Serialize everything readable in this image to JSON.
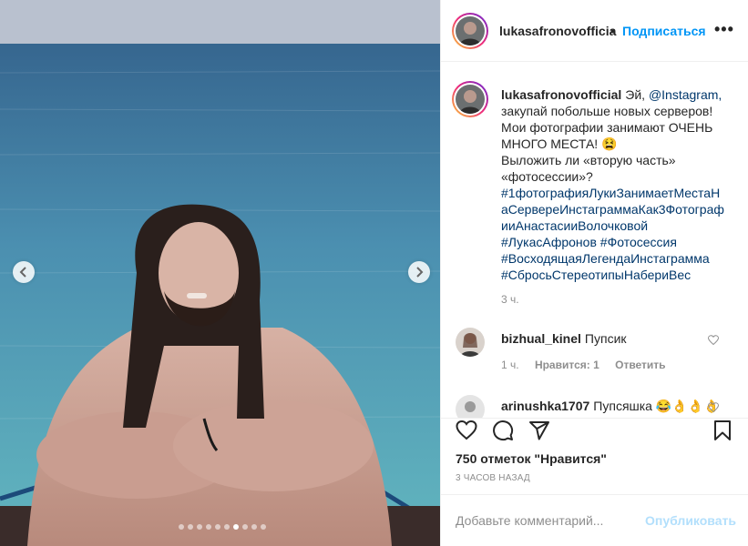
{
  "post": {
    "username": "lukasafronovofficia",
    "separator": "•",
    "follow_label": "Подписаться",
    "more_icon": "more-horizontal-icon",
    "more_label": "•••"
  },
  "caption": {
    "username": "lukasafronovofficial",
    "text_1": "Эй,",
    "mention": "@Instagram,",
    "text_2": "закупай побольше новых серверов! Мои фотографии занимают ОЧЕНЬ МНОГО МЕСТА! 😫",
    "text_3": "Выложить ли «вторую часть» «фотосессии»?",
    "hashtags": [
      "#1фотографияЛукиЗанимаетМестаНаСервереИнстаграммаКак3ФотографииАнастасииВолочковой",
      "#ЛукасАфронов #Фотосессия",
      "#ВосходящаяЛегендаИнстаграмма",
      "#СбросьСтереотипыНабериВес"
    ],
    "time": "3 ч."
  },
  "comments": [
    {
      "username": "bizhual_kinel",
      "text": "Пупсик",
      "time": "1 ч.",
      "likes": "Нравится: 1",
      "reply": "Ответить"
    },
    {
      "username": "arinushka1707",
      "text": "Пупсяшка 😂👌👌👌"
    }
  ],
  "actions": {
    "like_icon": "heart-icon",
    "comment_icon": "comment-icon",
    "share_icon": "share-icon",
    "save_icon": "bookmark-icon"
  },
  "likes_count": "750 отметок \"Нравится\"",
  "post_time": "3 часов назад",
  "add_comment": {
    "placeholder": "Добавьте комментарий...",
    "publish_label": "Опубликовать"
  },
  "carousel": {
    "slide_count": 10,
    "active_slide": 7
  },
  "colors": {
    "accent": "#0095f6",
    "publish_disabled": "#b2dffc",
    "muted": "#8e8e8e",
    "text": "#262626"
  }
}
